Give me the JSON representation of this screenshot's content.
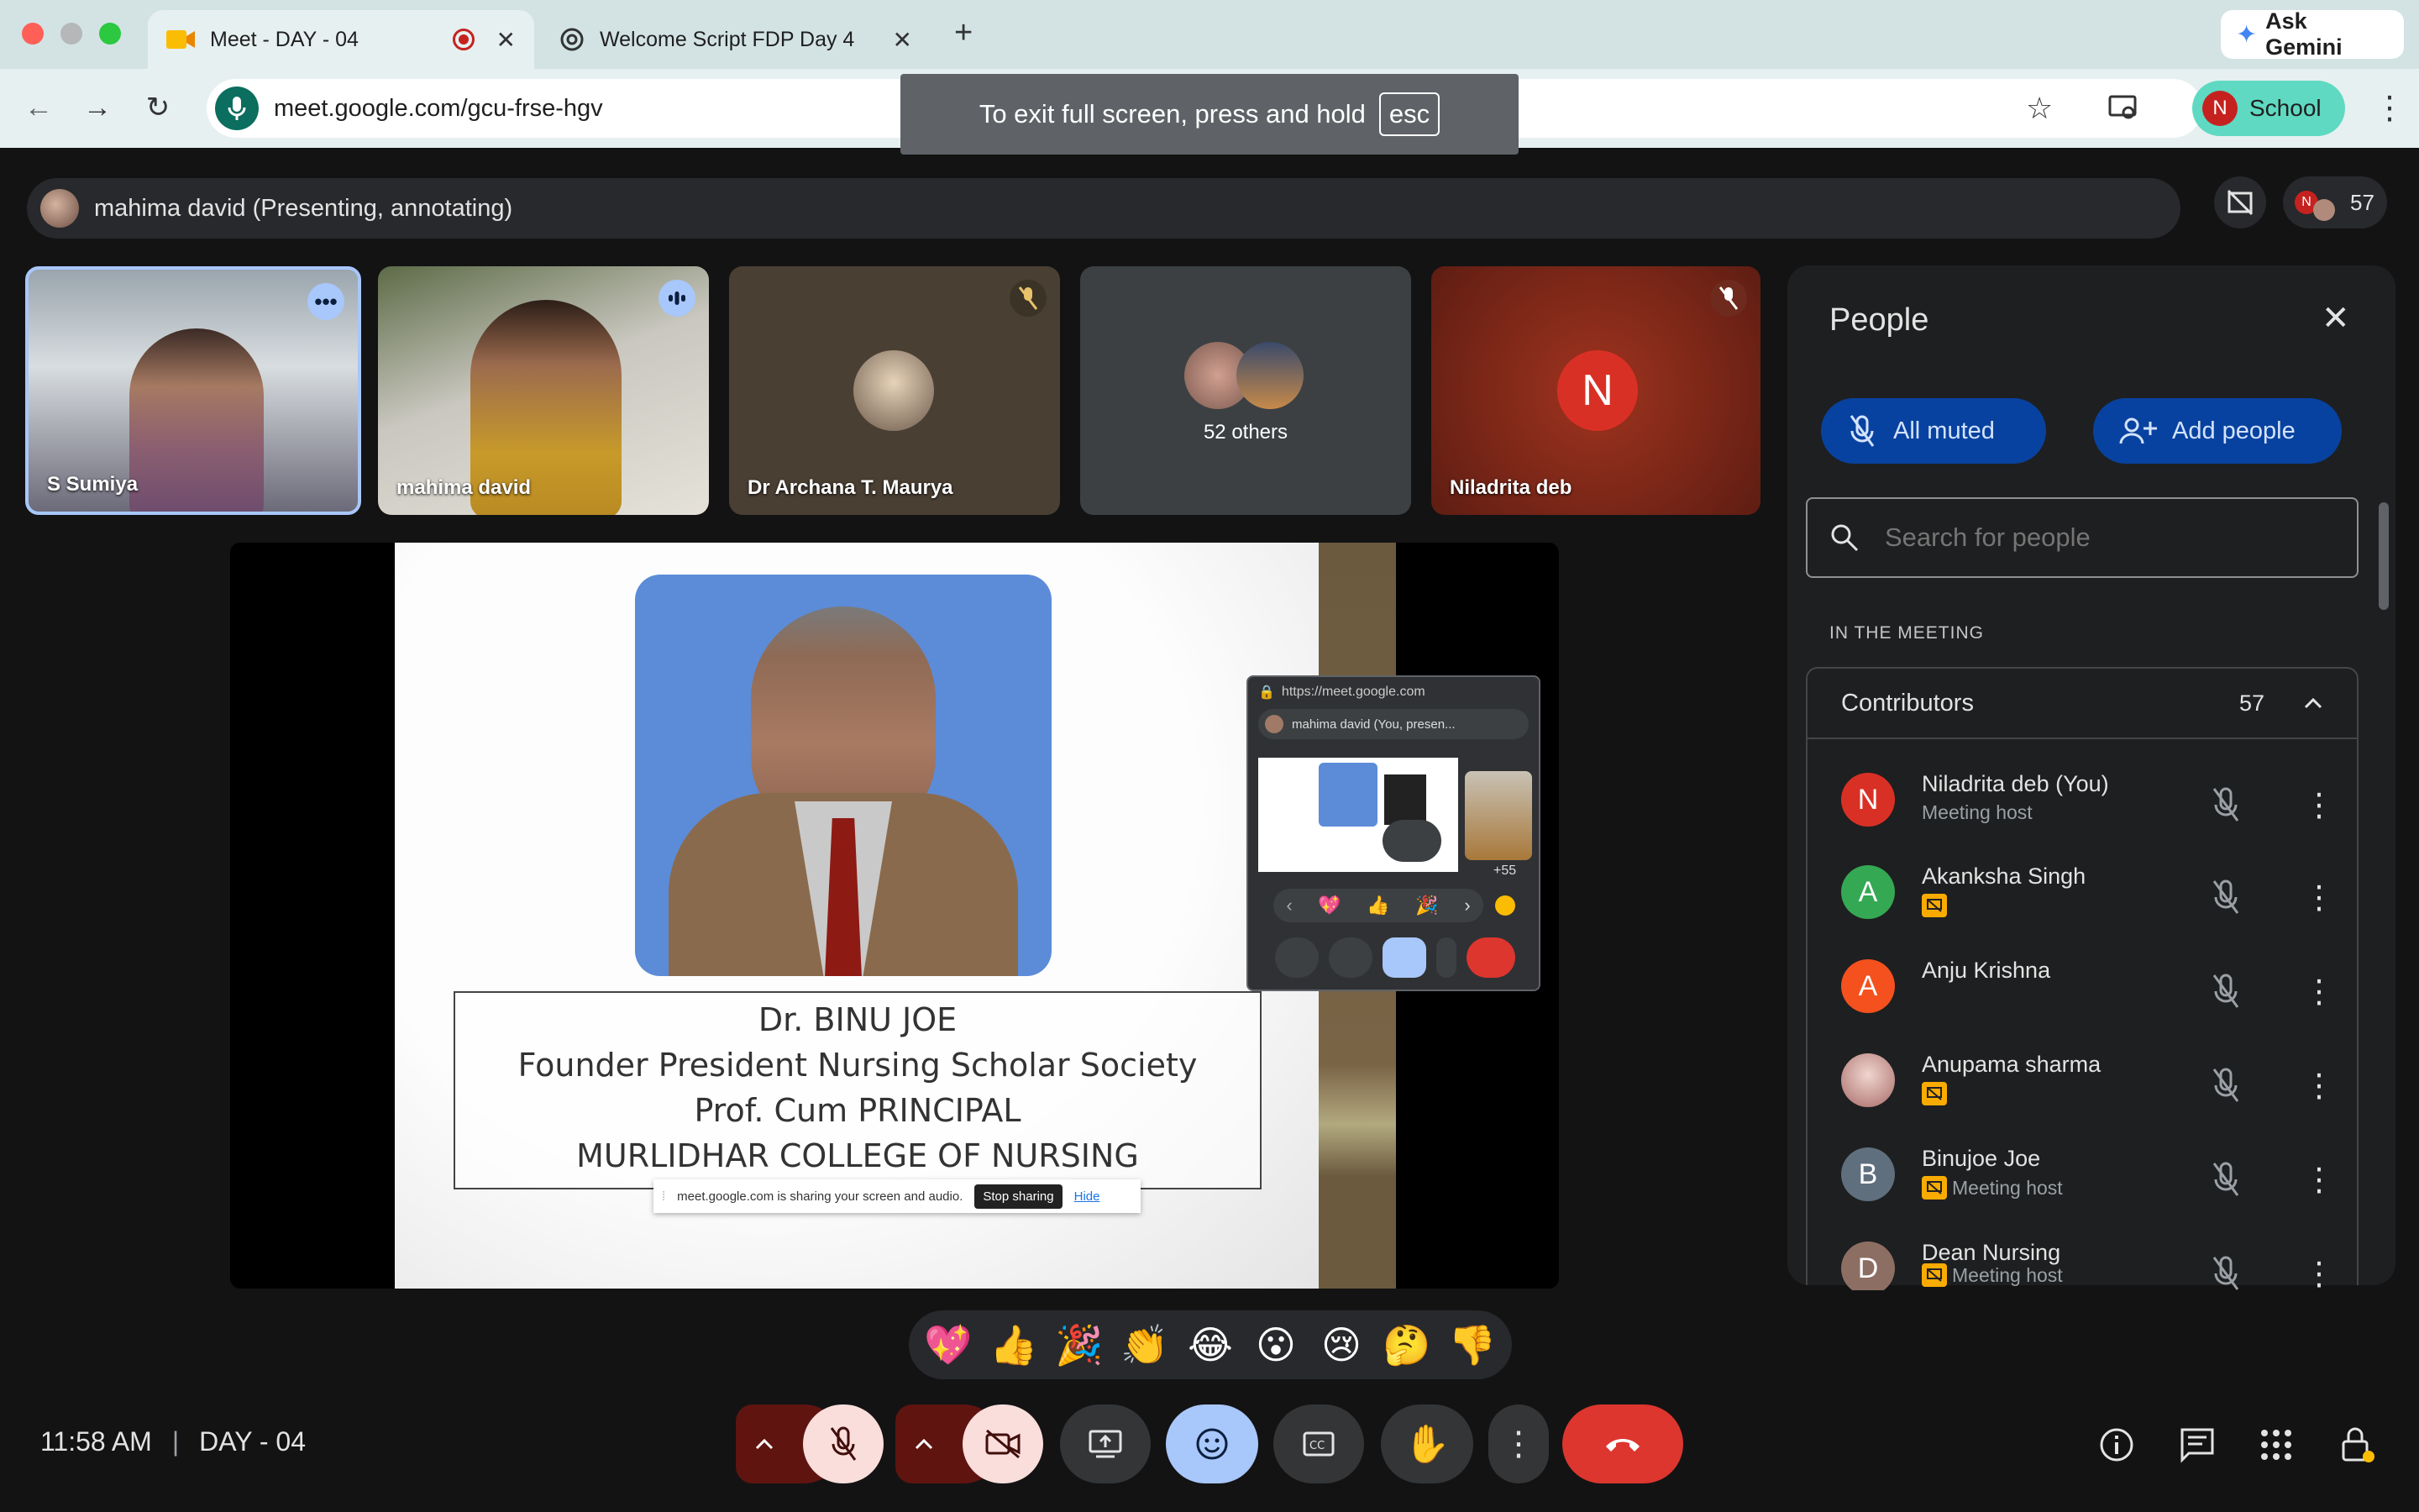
{
  "browser": {
    "tabs": [
      {
        "title": "Meet - DAY - 04",
        "active": true
      },
      {
        "title": "Welcome Script FDP Day 4",
        "active": false
      }
    ],
    "ask_gemini": "Ask Gemini",
    "url": "meet.google.com/gcu-frse-hgv",
    "profile_initial": "N",
    "profile_label": "School",
    "fullscreen_notice": "To exit full screen, press and hold",
    "fullscreen_key": "esc"
  },
  "meet": {
    "presenter_banner": "mahima david (Presenting, annotating)",
    "participant_count": "57",
    "participant_initial": "N",
    "tiles": [
      {
        "name": "S Sumiya"
      },
      {
        "name": "mahima david"
      },
      {
        "name": "Dr Archana T. Maurya"
      },
      {
        "name": "52 others"
      },
      {
        "name": "Niladrita deb",
        "initial": "N"
      }
    ],
    "slide": {
      "line1": "Dr. BINU JOE",
      "line2": "Founder President Nursing Scholar Society",
      "line3": "Prof. Cum PRINCIPAL",
      "line4": "MURLIDHAR COLLEGE OF NURSING",
      "share_notice": "meet.google.com is sharing your screen and audio.",
      "stop_sharing": "Stop sharing",
      "hide": "Hide"
    },
    "pip": {
      "url": "https://meet.google.com",
      "banner": "mahima david (You, presen...",
      "count": "+55"
    },
    "reactions": [
      "💖",
      "👍",
      "🎉",
      "👏",
      "😂",
      "😮",
      "😢",
      "🤔",
      "👎"
    ],
    "clock": "11:58 AM",
    "meeting_name": "DAY - 04"
  },
  "people": {
    "title": "People",
    "all_muted": "All muted",
    "add_people": "Add people",
    "search_placeholder": "Search for people",
    "section": "IN THE MEETING",
    "group_label": "Contributors",
    "group_count": "57",
    "list": [
      {
        "initial": "N",
        "name": "Niladrita deb (You)",
        "sub": "Meeting host",
        "color": "#d93025"
      },
      {
        "initial": "A",
        "name": "Akanksha Singh",
        "sub": "",
        "color": "#34a853"
      },
      {
        "initial": "A",
        "name": "Anju Krishna",
        "sub": "",
        "color": "#f4511e"
      },
      {
        "initial": "",
        "name": "Anupama sharma",
        "sub": "",
        "color": "#c98f8a"
      },
      {
        "initial": "B",
        "name": "Binujoe Joe",
        "sub": "Meeting host",
        "color": "#5f6f7d"
      },
      {
        "initial": "D",
        "name": "Dean Nursing",
        "sub": "Meeting host",
        "color": "#8d6e63"
      }
    ]
  }
}
